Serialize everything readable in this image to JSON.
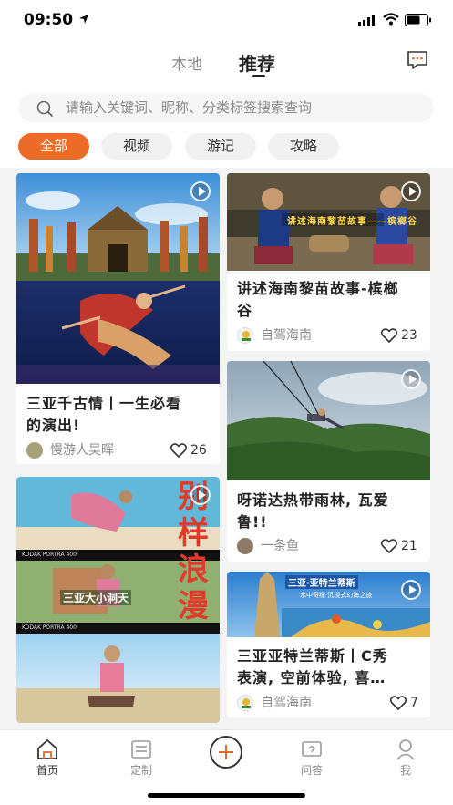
{
  "status_bar": {
    "time": "09:50"
  },
  "header": {
    "tab_local": "本地",
    "tab_recommend": "推荐"
  },
  "search": {
    "placeholder": "请输入关键词、昵称、分类标签搜索查询"
  },
  "filters": [
    "全部",
    "视频",
    "游记",
    "攻略"
  ],
  "active_filter": "全部",
  "cards": [
    {
      "title_lines": [
        "三亚千古情丨一生必看",
        "的演出!"
      ],
      "author": "慢游人吴晖",
      "likes": "26",
      "has_video": true
    },
    {
      "title_lines": [
        "讲述海南黎苗故事-槟榔",
        "谷"
      ],
      "author": "自驾海南",
      "likes": "23",
      "has_video": true,
      "overlay_caption": "讲述海南黎苗故事——槟榔谷"
    },
    {
      "title_lines": [
        "呀诺达热带雨林, 瓦爱",
        "鲁!!"
      ],
      "author": "一条鱼",
      "likes": "21",
      "has_video": true
    },
    {
      "title_lines": [
        "三亚亚特兰蒂斯丨C秀",
        "表演, 空前体验, 喜…"
      ],
      "author": "自驾海南",
      "likes": "7",
      "has_video": true,
      "overlay_caption": "三亚·亚特兰蒂斯",
      "overlay_subcaption": "水中奇缘·沉浸式幻海之旅"
    },
    {
      "title_lines": [],
      "author": "",
      "likes": "",
      "has_video": true,
      "overlay_caption": "别样浪漫",
      "overlay_subcaption": "三亚大小洞天",
      "film_label": "KODAK PORTRA 400"
    }
  ],
  "tabbar": {
    "home": "首页",
    "custom": "定制",
    "qa": "问答",
    "me": "我"
  },
  "colors": {
    "accent": "#ec6b26",
    "tab_active": "#333333",
    "tab_inactive": "#888888"
  }
}
